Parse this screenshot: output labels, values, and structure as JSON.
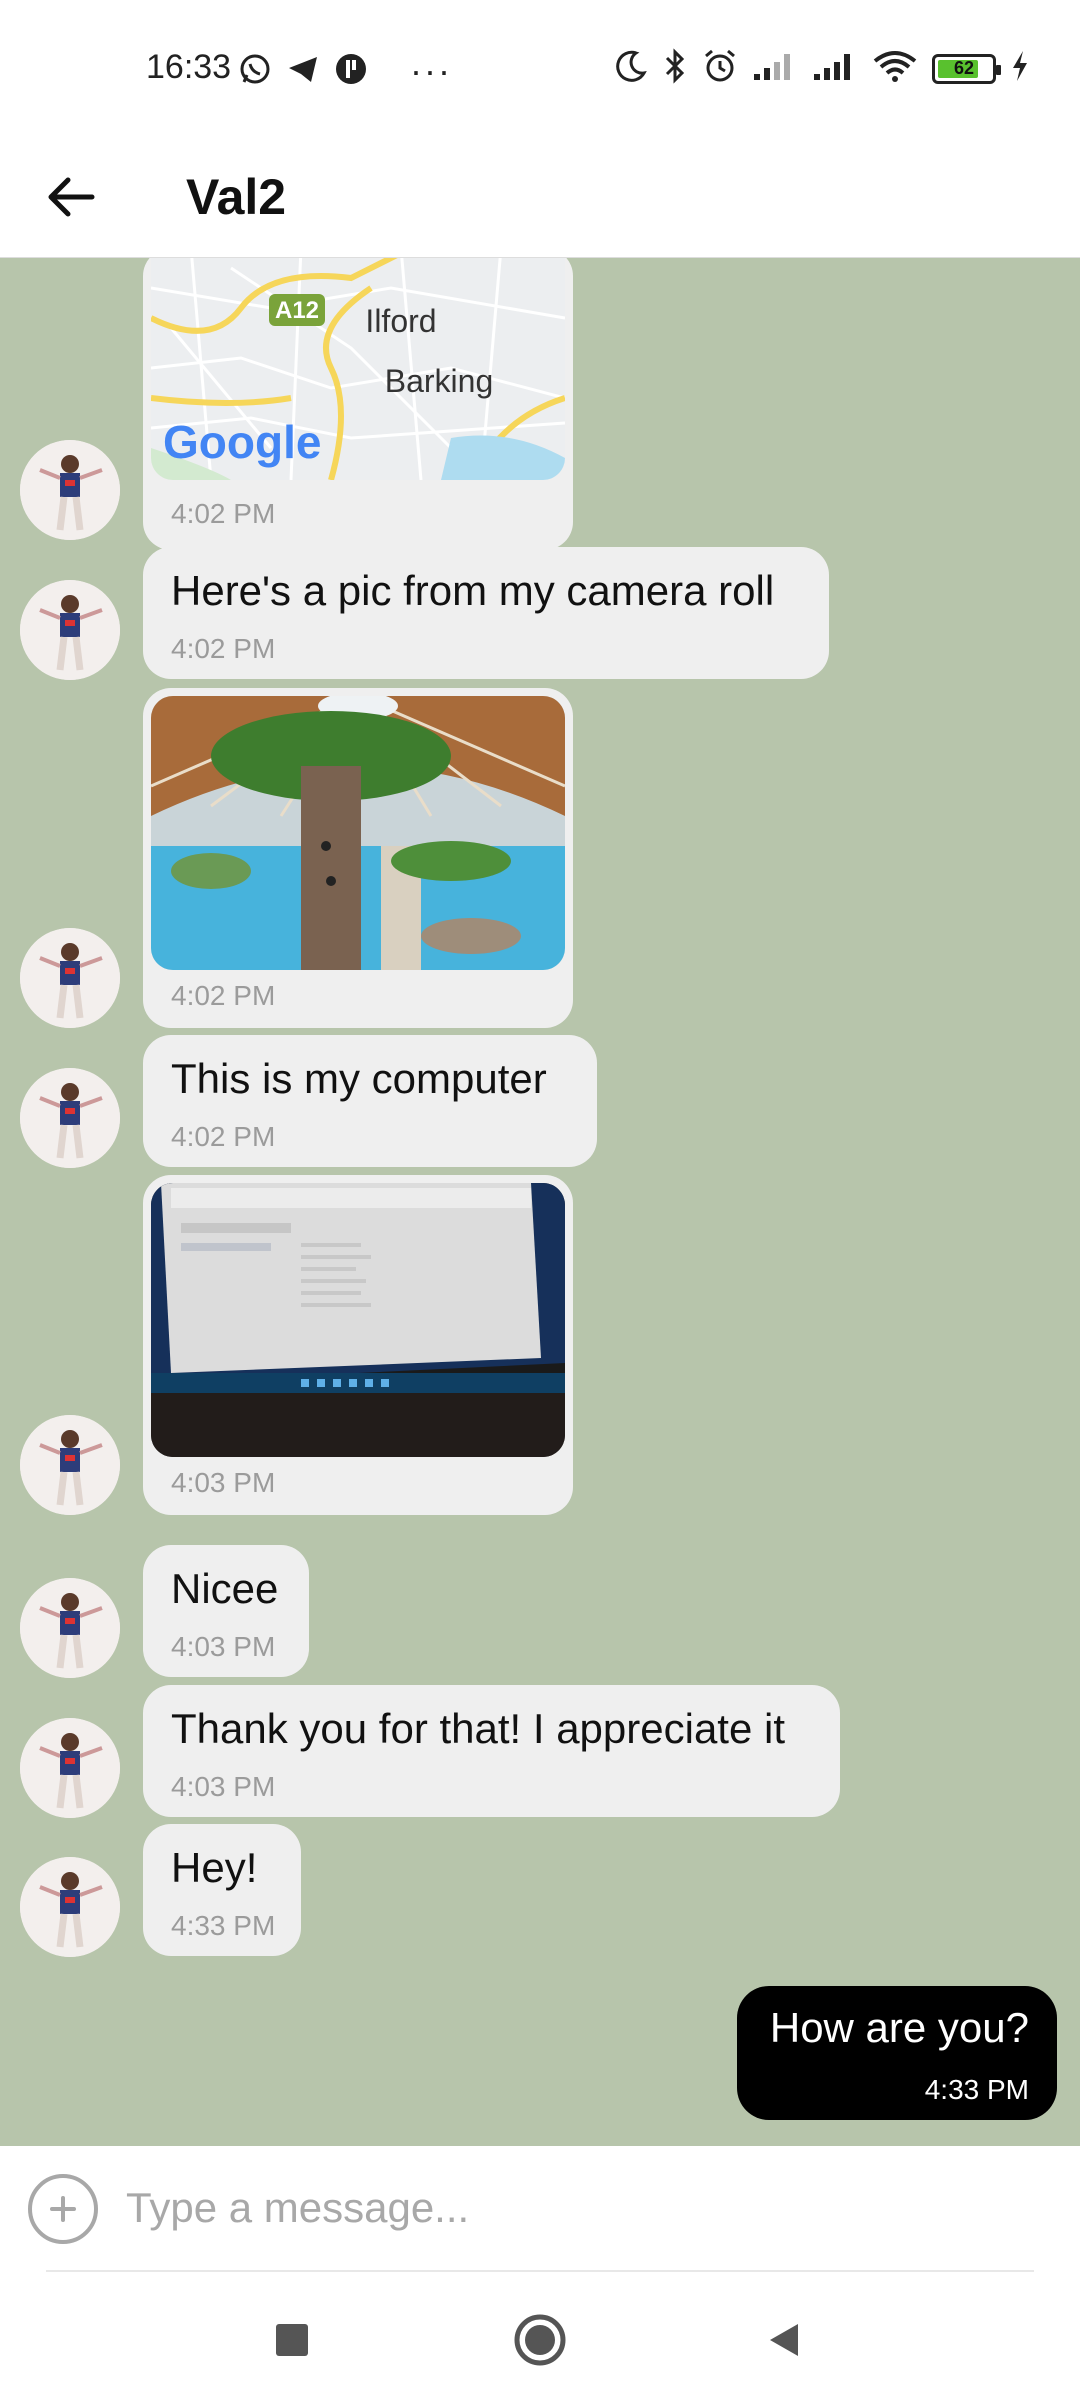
{
  "status_bar": {
    "time": "16:33",
    "battery": "62",
    "icons": [
      "whatsapp-icon",
      "telegram-icon",
      "app-icon",
      "more-dots",
      "moon-icon",
      "bluetooth-icon",
      "alarm-icon",
      "signal-icon",
      "signal-icon",
      "wifi-icon",
      "battery-icon",
      "charging-icon"
    ],
    "dots": "···"
  },
  "header": {
    "title": "Val2"
  },
  "map": {
    "road_label": "A12",
    "place1": "Ilford",
    "place2": "Barking",
    "logo": "Google"
  },
  "messages": [
    {
      "type": "image-map",
      "time": "4:02 PM"
    },
    {
      "type": "text",
      "text": "Here's a pic from my camera roll",
      "time": "4:02 PM"
    },
    {
      "type": "image",
      "time": "4:02 PM"
    },
    {
      "type": "text",
      "text": "This is my computer",
      "time": "4:02 PM"
    },
    {
      "type": "image",
      "time": "4:03 PM"
    },
    {
      "type": "text",
      "text": "Nicee",
      "time": "4:03 PM"
    },
    {
      "type": "text",
      "text": "Thank you for that! I appreciate it",
      "time": "4:03 PM"
    },
    {
      "type": "text",
      "text": "Hey!",
      "time": "4:33 PM"
    }
  ],
  "outgoing": {
    "text": "How are you?",
    "time": "4:33 PM"
  },
  "composer": {
    "placeholder": "Type a message..."
  },
  "colors": {
    "chat_background": "#b7c5ab",
    "incoming_bubble": "#efefef",
    "outgoing_bubble": "#000000"
  }
}
